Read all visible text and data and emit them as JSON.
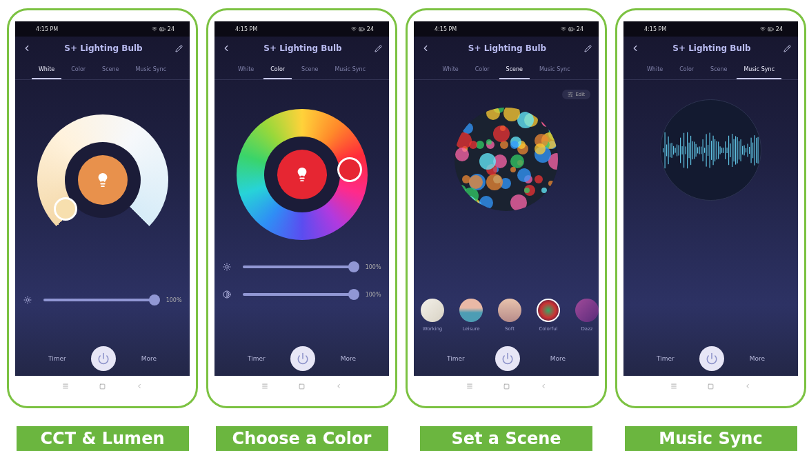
{
  "phones": [
    {
      "time": "4:15 PM",
      "battery": "24",
      "title": "S+ Lighting Bulb",
      "tabs": [
        {
          "label": "White",
          "selected": true
        },
        {
          "label": "Color",
          "selected": false
        },
        {
          "label": "Scene",
          "selected": false
        },
        {
          "label": "Music Sync",
          "selected": false
        }
      ],
      "panel": {
        "kind": "white",
        "sliders": [
          {
            "level": 1,
            "reading": "100%"
          }
        ]
      },
      "timer": "Timer",
      "more": "More",
      "caption": "CCT & Lumen"
    },
    {
      "time": "4:15 PM",
      "battery": "24",
      "title": "S+ Lighting Bulb",
      "tabs": [
        {
          "label": "White",
          "selected": false
        },
        {
          "label": "Color",
          "selected": true
        },
        {
          "label": "Scene",
          "selected": false
        },
        {
          "label": "Music Sync",
          "selected": false
        }
      ],
      "panel": {
        "kind": "color",
        "sliders": [
          {
            "level": 1,
            "reading": "100%"
          },
          {
            "level": 1,
            "reading": "100%"
          }
        ]
      },
      "timer": "Timer",
      "more": "More",
      "caption": "Choose a Color"
    },
    {
      "time": "4:15 PM",
      "battery": "24",
      "title": "S+ Lighting Bulb",
      "tabs": [
        {
          "label": "White",
          "selected": false
        },
        {
          "label": "Color",
          "selected": false
        },
        {
          "label": "Scene",
          "selected": true
        },
        {
          "label": "Music Sync",
          "selected": false
        }
      ],
      "panel": {
        "kind": "scene",
        "edit": "Edit",
        "scenes": [
          {
            "label": "Working",
            "selected": false
          },
          {
            "label": "Leisure",
            "selected": false
          },
          {
            "label": "Soft",
            "selected": false
          },
          {
            "label": "Colorful",
            "selected": true
          },
          {
            "label": "Dazz",
            "selected": false
          }
        ]
      },
      "timer": "Timer",
      "more": "More",
      "caption": "Set a Scene"
    },
    {
      "time": "4:15 PM",
      "battery": "24",
      "title": "S+ Lighting Bulb",
      "tabs": [
        {
          "label": "White",
          "selected": false
        },
        {
          "label": "Color",
          "selected": false
        },
        {
          "label": "Scene",
          "selected": false
        },
        {
          "label": "Music Sync",
          "selected": true
        }
      ],
      "panel": {
        "kind": "music"
      },
      "timer": "Timer",
      "more": "More",
      "caption": "Music Sync"
    }
  ]
}
